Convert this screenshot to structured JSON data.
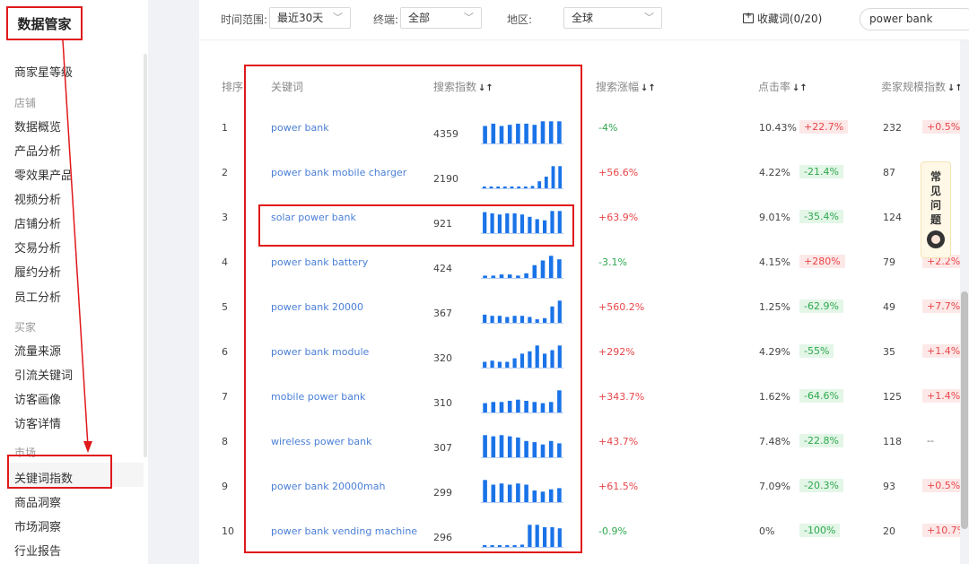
{
  "sidebar": {
    "app_title": "数据管家",
    "seller_level": "商家星等级",
    "groups": [
      {
        "label": "店铺",
        "items": [
          "数据概览",
          "产品分析",
          "零效果产品",
          "视频分析",
          "店铺分析",
          "交易分析",
          "履约分析",
          "员工分析"
        ]
      },
      {
        "label": "买家",
        "items": [
          "流量来源",
          "引流关键词",
          "访客画像",
          "访客详情"
        ]
      },
      {
        "label": "市场",
        "items": [
          "关键词指数",
          "商品洞察",
          "市场洞察",
          "行业报告"
        ]
      }
    ],
    "active_item": "关键词指数"
  },
  "filters": {
    "time_label": "时间范围:",
    "time_value": "最近30天",
    "terminal_label": "终端:",
    "terminal_value": "全部",
    "region_label": "地区:",
    "region_value": "全球",
    "favorites": "收藏词(0/20)",
    "search_value": "power bank"
  },
  "table": {
    "headers": {
      "rank": "排序",
      "keyword": "关键词",
      "index": "搜索指数",
      "growth": "搜索涨幅",
      "ctr": "点击率",
      "seller": "卖家规模指数"
    },
    "rows": [
      {
        "rank": "1",
        "keyword": "power bank",
        "index": "4359",
        "trend": [
          0.75,
          0.85,
          0.75,
          0.8,
          0.85,
          0.85,
          0.8,
          0.95,
          0.95,
          0.95
        ],
        "growth": "-4%",
        "growth_dir": "neg",
        "ctr": "10.43%",
        "ctr_change": "+22.7%",
        "ctr_dir": "pos",
        "seller": "232",
        "seller_change": "+0.5%",
        "seller_dir": "pos"
      },
      {
        "rank": "2",
        "keyword": "power bank mobile charger",
        "index": "2190",
        "trend": [
          0.05,
          0.05,
          0.05,
          0.05,
          0.05,
          0.05,
          0.05,
          0.1,
          0.3,
          0.5,
          0.95,
          0.95
        ],
        "growth": "+56.6%",
        "growth_dir": "pos",
        "ctr": "4.22%",
        "ctr_change": "-21.4%",
        "ctr_dir": "neg",
        "seller": "87",
        "seller_change": "",
        "seller_dir": "pos"
      },
      {
        "rank": "3",
        "keyword": "solar power bank",
        "index": "921",
        "trend": [
          0.9,
          0.85,
          0.8,
          0.85,
          0.85,
          0.8,
          0.7,
          0.6,
          0.55,
          0.95,
          0.95
        ],
        "growth": "+63.9%",
        "growth_dir": "pos",
        "ctr": "9.01%",
        "ctr_change": "-35.4%",
        "ctr_dir": "neg",
        "seller": "124",
        "seller_change": "",
        "seller_dir": "pos"
      },
      {
        "rank": "4",
        "keyword": "power bank battery",
        "index": "424",
        "trend": [
          0.1,
          0.1,
          0.15,
          0.15,
          0.1,
          0.2,
          0.55,
          0.75,
          0.95,
          0.8
        ],
        "growth": "-3.1%",
        "growth_dir": "neg",
        "ctr": "4.15%",
        "ctr_change": "+280%",
        "ctr_dir": "pos",
        "seller": "79",
        "seller_change": "+2.2%",
        "seller_dir": "pos"
      },
      {
        "rank": "5",
        "keyword": "power bank 20000",
        "index": "367",
        "trend": [
          0.35,
          0.3,
          0.3,
          0.25,
          0.3,
          0.3,
          0.25,
          0.15,
          0.2,
          0.7,
          0.95
        ],
        "growth": "+560.2%",
        "growth_dir": "pos",
        "ctr": "1.25%",
        "ctr_change": "-62.9%",
        "ctr_dir": "neg",
        "seller": "49",
        "seller_change": "+7.7%",
        "seller_dir": "pos"
      },
      {
        "rank": "6",
        "keyword": "power bank module",
        "index": "320",
        "trend": [
          0.25,
          0.3,
          0.25,
          0.25,
          0.4,
          0.6,
          0.7,
          0.95,
          0.6,
          0.75,
          0.95
        ],
        "growth": "+292%",
        "growth_dir": "pos",
        "ctr": "4.29%",
        "ctr_change": "-55%",
        "ctr_dir": "neg",
        "seller": "35",
        "seller_change": "+1.4%",
        "seller_dir": "pos"
      },
      {
        "rank": "7",
        "keyword": "mobile power bank",
        "index": "310",
        "trend": [
          0.4,
          0.45,
          0.45,
          0.5,
          0.55,
          0.5,
          0.45,
          0.4,
          0.45,
          0.95
        ],
        "growth": "+343.7%",
        "growth_dir": "pos",
        "ctr": "1.62%",
        "ctr_change": "-64.6%",
        "ctr_dir": "neg",
        "seller": "125",
        "seller_change": "+1.4%",
        "seller_dir": "pos"
      },
      {
        "rank": "8",
        "keyword": "wireless power bank",
        "index": "307",
        "trend": [
          0.95,
          0.9,
          0.95,
          0.9,
          0.85,
          0.7,
          0.65,
          0.55,
          0.7,
          0.6
        ],
        "growth": "+43.7%",
        "growth_dir": "pos",
        "ctr": "7.48%",
        "ctr_change": "-22.8%",
        "ctr_dir": "neg",
        "seller": "118",
        "seller_change": "--",
        "seller_dir": "none"
      },
      {
        "rank": "9",
        "keyword": "power bank 20000mah",
        "index": "299",
        "trend": [
          0.95,
          0.75,
          0.8,
          0.75,
          0.8,
          0.75,
          0.5,
          0.45,
          0.55,
          0.6
        ],
        "growth": "+61.5%",
        "growth_dir": "pos",
        "ctr": "7.09%",
        "ctr_change": "-20.3%",
        "ctr_dir": "neg",
        "seller": "93",
        "seller_change": "+0.5%",
        "seller_dir": "pos"
      },
      {
        "rank": "10",
        "keyword": "power bank vending machine",
        "index": "296",
        "trend": [
          0.05,
          0.05,
          0.05,
          0.05,
          0.05,
          0.1,
          0.95,
          0.95,
          0.85,
          0.85,
          0.8
        ],
        "growth": "-0.9%",
        "growth_dir": "neg",
        "ctr": "0%",
        "ctr_change": "-100%",
        "ctr_dir": "neg",
        "seller": "20",
        "seller_change": "+10.7%",
        "seller_dir": "pos"
      }
    ]
  },
  "faq": {
    "chars": [
      "常",
      "见",
      "问",
      "题"
    ]
  },
  "colors": {
    "accent": "#1a73e8",
    "annotation": "#e0191b",
    "positive": "#e8464a",
    "negative": "#2fa84f"
  }
}
